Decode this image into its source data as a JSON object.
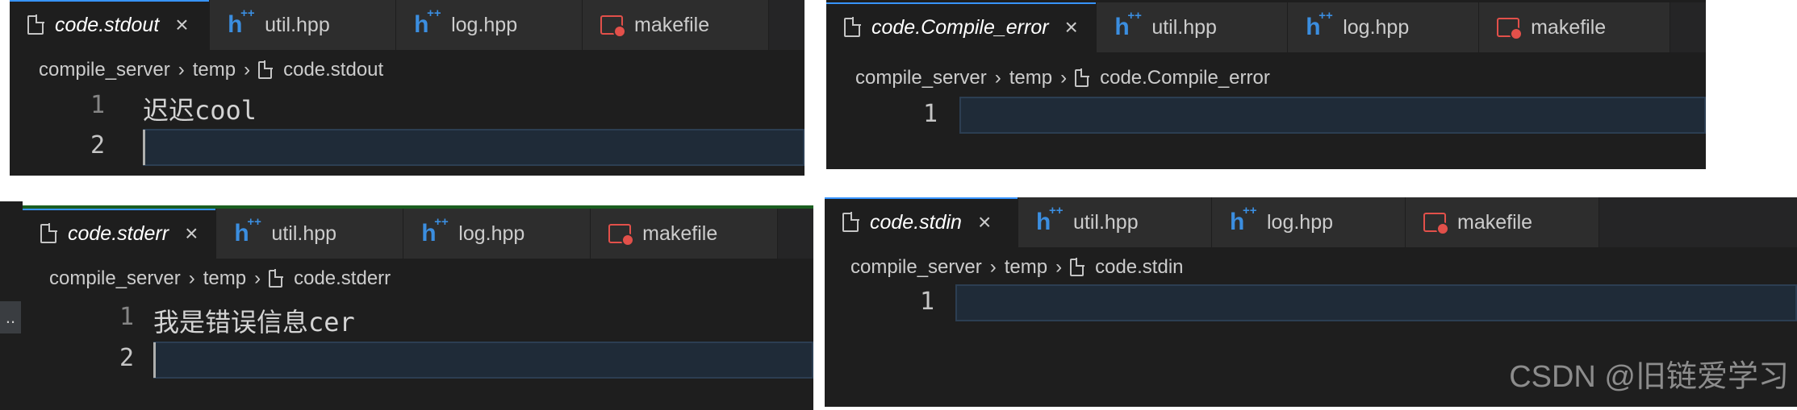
{
  "panels": {
    "p1": {
      "tabs": [
        {
          "label": "code.stdout",
          "icon": "file-icon",
          "active": true
        },
        {
          "label": "util.hpp",
          "icon": "cpp-header-icon"
        },
        {
          "label": "log.hpp",
          "icon": "cpp-header-icon"
        },
        {
          "label": "makefile",
          "icon": "makefile-icon"
        }
      ],
      "breadcrumb": [
        "compile_server",
        "temp",
        "code.stdout"
      ],
      "lines": [
        {
          "num": "1",
          "text": "迟迟cool"
        },
        {
          "num": "2",
          "text": ""
        }
      ]
    },
    "p2": {
      "tabs": [
        {
          "label": "code.Compile_error",
          "icon": "file-icon",
          "active": true
        },
        {
          "label": "util.hpp",
          "icon": "cpp-header-icon"
        },
        {
          "label": "log.hpp",
          "icon": "cpp-header-icon"
        },
        {
          "label": "makefile",
          "icon": "makefile-icon"
        }
      ],
      "breadcrumb": [
        "compile_server",
        "temp",
        "code.Compile_error"
      ],
      "lines": [
        {
          "num": "1",
          "text": ""
        }
      ]
    },
    "p3": {
      "tabs": [
        {
          "label": "code.stderr",
          "icon": "file-icon",
          "active": true
        },
        {
          "label": "util.hpp",
          "icon": "cpp-header-icon"
        },
        {
          "label": "log.hpp",
          "icon": "cpp-header-icon"
        },
        {
          "label": "makefile",
          "icon": "makefile-icon"
        }
      ],
      "breadcrumb": [
        "compile_server",
        "temp",
        "code.stderr"
      ],
      "lines": [
        {
          "num": "1",
          "text": "我是错误信息cer"
        },
        {
          "num": "2",
          "text": ""
        }
      ]
    },
    "p4": {
      "tabs": [
        {
          "label": "code.stdin",
          "icon": "file-icon",
          "active": true
        },
        {
          "label": "util.hpp",
          "icon": "cpp-header-icon"
        },
        {
          "label": "log.hpp",
          "icon": "cpp-header-icon"
        },
        {
          "label": "makefile",
          "icon": "makefile-icon"
        }
      ],
      "breadcrumb": [
        "compile_server",
        "temp",
        "code.stdin"
      ],
      "lines": [
        {
          "num": "1",
          "text": ""
        }
      ]
    }
  },
  "glyphs": {
    "close": "×",
    "chevron": "›",
    "h": "h",
    "plusplus": "++"
  },
  "side_ellipsis": "..",
  "watermark": "CSDN @旧链爱学习",
  "colors": {
    "accent": "#3794ff",
    "cpp_icon": "#3b8ee0",
    "makefile_icon": "#e2504a",
    "current_line": "#1f2b38"
  }
}
